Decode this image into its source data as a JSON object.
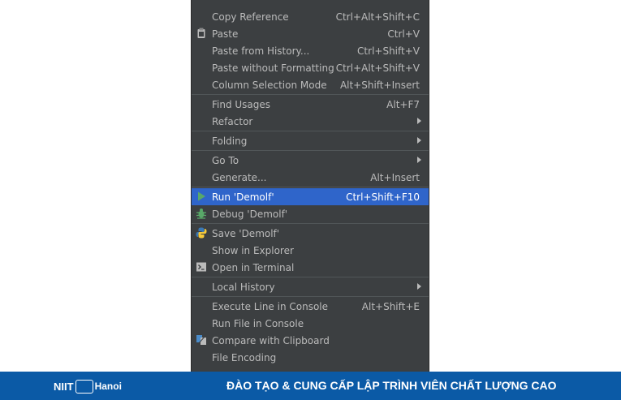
{
  "menu": {
    "items": [
      {
        "label": "Copy Reference",
        "shortcut": "Ctrl+Alt+Shift+C"
      },
      {
        "label": "Paste",
        "shortcut": "Ctrl+V",
        "icon": "clipboard-icon"
      },
      {
        "label": "Paste from History...",
        "shortcut": "Ctrl+Shift+V"
      },
      {
        "label": "Paste without Formatting",
        "shortcut": "Ctrl+Alt+Shift+V"
      },
      {
        "label": "Column Selection Mode",
        "shortcut": "Alt+Shift+Insert"
      },
      {
        "label": "Find Usages",
        "shortcut": "Alt+F7"
      },
      {
        "label": "Refactor",
        "submenu": true
      },
      {
        "label": "Folding",
        "submenu": true
      },
      {
        "label": "Go To",
        "submenu": true
      },
      {
        "label": "Generate...",
        "shortcut": "Alt+Insert"
      },
      {
        "label": "Run 'Demolf'",
        "shortcut": "Ctrl+Shift+F10",
        "icon": "run-icon",
        "selected": true
      },
      {
        "label": "Debug 'Demolf'",
        "icon": "debug-icon"
      },
      {
        "label": "Save 'Demolf'",
        "icon": "python-icon"
      },
      {
        "label": "Show in Explorer"
      },
      {
        "label": "Open in Terminal",
        "icon": "terminal-icon"
      },
      {
        "label": "Local History",
        "submenu": true
      },
      {
        "label": "Execute Line in Console",
        "shortcut": "Alt+Shift+E"
      },
      {
        "label": "Run File in Console"
      },
      {
        "label": "Compare with Clipboard",
        "icon": "compare-icon"
      },
      {
        "label": "File Encoding"
      }
    ],
    "colors": {
      "background": "#3c3f41",
      "selected": "#2f65ca",
      "text": "#bbbbbb",
      "separator": "#515658"
    }
  },
  "footer": {
    "logo_brand": "NIIT",
    "logo_city": "Hanoi",
    "slogan": "ĐÀO TẠO & CUNG CẤP LẬP TRÌNH VIÊN CHẤT LƯỢNG CAO",
    "background": "#0b5aa6"
  }
}
